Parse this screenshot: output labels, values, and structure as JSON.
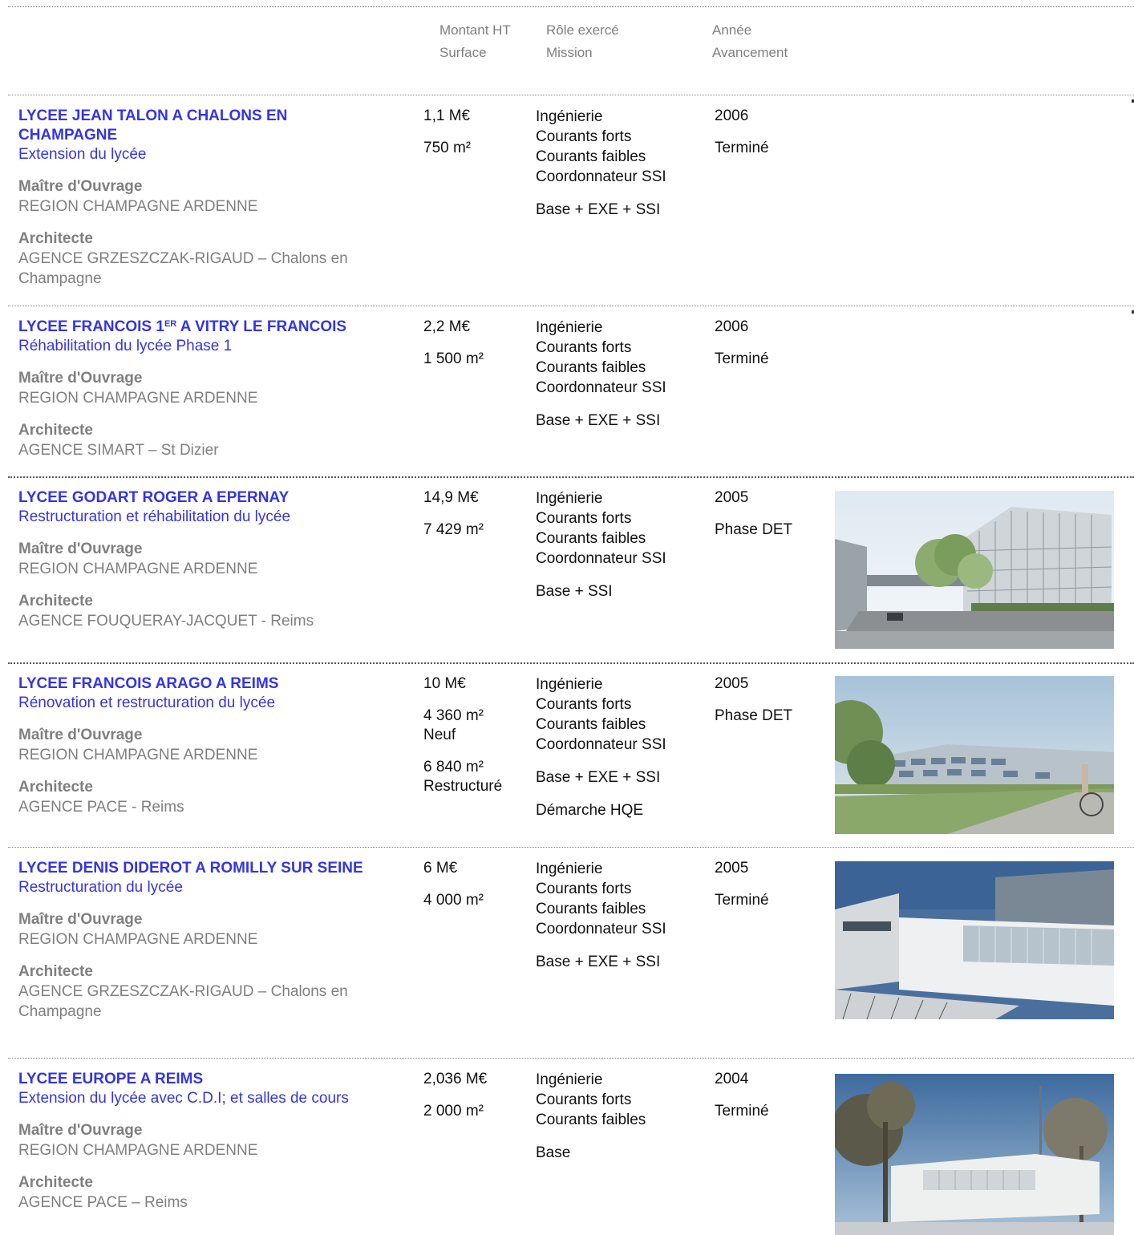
{
  "header": {
    "montant": "Montant HT",
    "surface": "Surface",
    "role": "Rôle exercé",
    "mission": "Mission",
    "annee": "Année",
    "avancement": "Avancement"
  },
  "labels": {
    "maitre": "Maître d'Ouvrage",
    "architecte": "Architecte"
  },
  "projects": [
    {
      "title": "LYCEE JEAN TALON A CHALONS EN CHAMPAGNE",
      "subtitle": "Extension du lycée",
      "maitre": "REGION CHAMPAGNE ARDENNE",
      "architecte": "AGENCE GRZESZCZAK-RIGAUD – Chalons en Champagne",
      "montant": "1,1 M€",
      "surface": [
        "750 m²"
      ],
      "roles": [
        "Ingénierie",
        "Courants forts",
        "Courants faibles",
        "Coordonnateur SSI"
      ],
      "mission": "Base + EXE + SSI",
      "extra": "",
      "annee": "2006",
      "avancement": "Terminé",
      "image": ""
    },
    {
      "title_main": "LYCEE FRANCOIS 1",
      "title_sup": "ER",
      "title_rest": " A VITRY LE FRANCOIS",
      "subtitle": "Réhabilitation du lycée Phase 1",
      "maitre": "REGION CHAMPAGNE ARDENNE",
      "architecte": "AGENCE SIMART – St Dizier",
      "montant": "2,2 M€",
      "surface": [
        "1 500 m²"
      ],
      "roles": [
        "Ingénierie",
        "Courants forts",
        "Courants faibles",
        "Coordonnateur SSI"
      ],
      "mission": "Base + EXE + SSI",
      "extra": "",
      "annee": "2006",
      "avancement": "Terminé",
      "image": ""
    },
    {
      "title": "LYCEE GODART ROGER A EPERNAY",
      "subtitle": "Restructuration et réhabilitation du lycée",
      "maitre": "REGION CHAMPAGNE ARDENNE",
      "architecte": "AGENCE FOUQUERAY-JACQUET - Reims",
      "montant": "14,9 M€",
      "surface": [
        "7 429 m²"
      ],
      "roles": [
        "Ingénierie",
        "Courants forts",
        "Courants faibles",
        "Coordonnateur SSI"
      ],
      "mission": "Base + SSI",
      "extra": "",
      "annee": "2005",
      "avancement": "Phase DET",
      "image": "building-photo"
    },
    {
      "title": "LYCEE FRANCOIS ARAGO A REIMS",
      "subtitle": "Rénovation et restructuration du lycée",
      "maitre": "REGION CHAMPAGNE ARDENNE",
      "architecte": "AGENCE PACE - Reims",
      "montant": "10 M€",
      "surface": [
        "4 360 m² Neuf",
        "6 840 m² Restructuré"
      ],
      "roles": [
        "Ingénierie",
        "Courants forts",
        "Courants faibles",
        "Coordonnateur SSI"
      ],
      "mission": "Base + EXE + SSI",
      "extra": "Démarche HQE",
      "annee": "2005",
      "avancement": "Phase DET",
      "image": "building-photo"
    },
    {
      "title": "LYCEE DENIS DIDEROT A ROMILLY SUR SEINE",
      "subtitle": "Restructuration du lycée",
      "maitre": "REGION CHAMPAGNE ARDENNE",
      "architecte": "AGENCE GRZESZCZAK-RIGAUD – Chalons en Champagne",
      "montant": "6 M€",
      "surface": [
        "4 000 m²"
      ],
      "roles": [
        "Ingénierie",
        "Courants forts",
        "Courants faibles",
        "Coordonnateur SSI"
      ],
      "mission": "Base + EXE + SSI",
      "extra": "",
      "annee": "2005",
      "avancement": "Terminé",
      "image": "building-photo"
    },
    {
      "title": "LYCEE EUROPE A REIMS",
      "subtitle": "Extension du lycée avec C.D.I; et salles de cours",
      "maitre": "REGION CHAMPAGNE ARDENNE",
      "architecte": "AGENCE PACE – Reims",
      "montant": "2,036 M€",
      "surface": [
        "2 000 m²"
      ],
      "roles": [
        "Ingénierie",
        "Courants forts",
        "Courants faibles"
      ],
      "mission": "Base",
      "extra": "",
      "annee": "2004",
      "avancement": "Terminé",
      "image": "building-photo"
    }
  ],
  "colors": {
    "title_blue": "#3434e8",
    "label_grey": "#7f7f7f",
    "text": "#111111"
  }
}
